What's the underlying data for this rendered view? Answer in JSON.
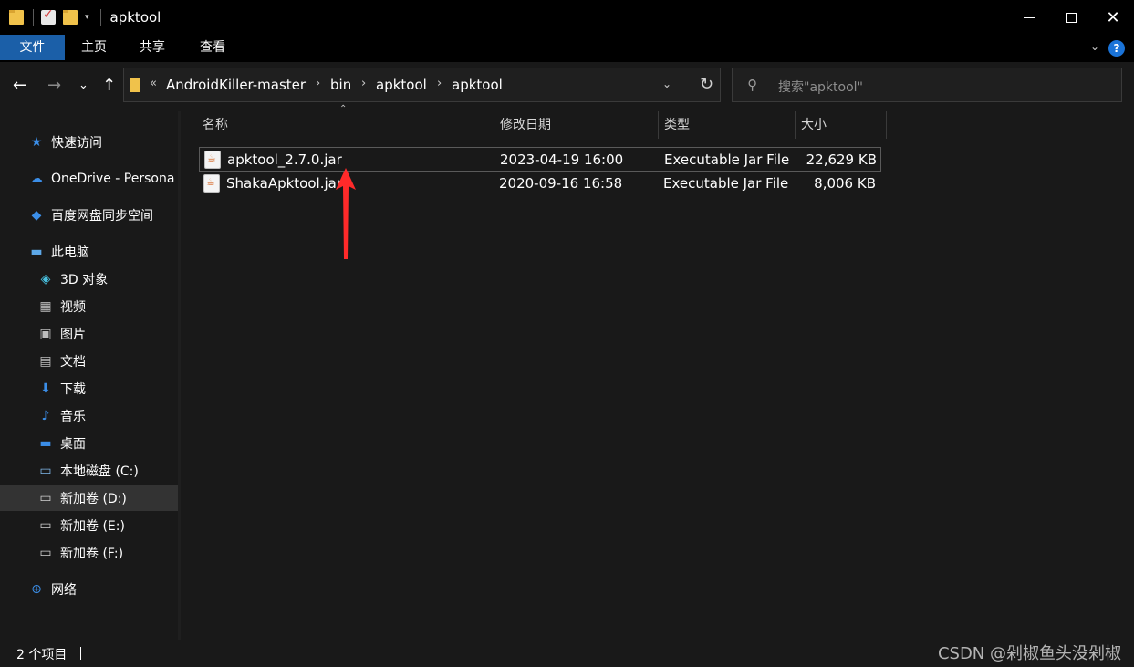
{
  "window": {
    "title": "apktool",
    "qa_dropdown": "▾",
    "minimize": "",
    "maximize": "",
    "close": "✕"
  },
  "ribbon": {
    "tabs": [
      {
        "label": "文件",
        "active": true
      },
      {
        "label": "主页",
        "active": false
      },
      {
        "label": "共享",
        "active": false
      },
      {
        "label": "查看",
        "active": false
      }
    ],
    "expand": "⌄",
    "help": "?"
  },
  "nav": {
    "back": "←",
    "forward": "→",
    "recent": "⌄",
    "up": "↑"
  },
  "address": {
    "overflow": "«",
    "segments": [
      "AndroidKiller-master",
      "bin",
      "apktool",
      "apktool"
    ],
    "separator": "›",
    "dropdown": "⌄",
    "refresh": "↻"
  },
  "search": {
    "placeholder": "搜索\"apktool\""
  },
  "sidebar": {
    "items": [
      {
        "label": "快速访问",
        "icon": "star-icon",
        "glyph": "★",
        "color": "#3b8ee8"
      },
      {
        "label": "OneDrive - Persona",
        "icon": "cloud-icon",
        "glyph": "☁",
        "color": "#3b8ee8"
      },
      {
        "label": "百度网盘同步空间",
        "icon": "baidu-sync-icon",
        "glyph": "◆",
        "color": "#3b8ee8"
      },
      {
        "label": "此电脑",
        "icon": "computer-icon",
        "glyph": "▬",
        "color": "#5da8e8"
      },
      {
        "label": "3D 对象",
        "icon": "cube-icon",
        "glyph": "◈",
        "color": "#49c1e0"
      },
      {
        "label": "视频",
        "icon": "video-icon",
        "glyph": "▦",
        "color": "#bcbcbc"
      },
      {
        "label": "图片",
        "icon": "picture-icon",
        "glyph": "▣",
        "color": "#bcbcbc"
      },
      {
        "label": "文档",
        "icon": "document-icon",
        "glyph": "▤",
        "color": "#bcbcbc"
      },
      {
        "label": "下载",
        "icon": "download-icon",
        "glyph": "⬇",
        "color": "#3b8ee8"
      },
      {
        "label": "音乐",
        "icon": "music-icon",
        "glyph": "♪",
        "color": "#3b8ee8"
      },
      {
        "label": "桌面",
        "icon": "desktop-icon",
        "glyph": "▬",
        "color": "#3b8ee8"
      },
      {
        "label": "本地磁盘 (C:)",
        "icon": "drive-c-icon",
        "glyph": "▭",
        "color": "#7fb7e8"
      },
      {
        "label": "新加卷 (D:)",
        "icon": "drive-icon",
        "glyph": "▭",
        "color": "#d0d0d0"
      },
      {
        "label": "新加卷 (E:)",
        "icon": "drive-icon",
        "glyph": "▭",
        "color": "#d0d0d0"
      },
      {
        "label": "新加卷 (F:)",
        "icon": "drive-icon",
        "glyph": "▭",
        "color": "#d0d0d0"
      },
      {
        "label": "网络",
        "icon": "network-icon",
        "glyph": "⊕",
        "color": "#3b8ee8"
      }
    ]
  },
  "columns": {
    "name": "名称",
    "date": "修改日期",
    "type": "类型",
    "size": "大小",
    "sort": "⌃"
  },
  "files": [
    {
      "name": "apktool_2.7.0.jar",
      "date": "2023-04-19 16:00",
      "type": "Executable Jar File",
      "size": "22,629 KB"
    },
    {
      "name": "ShakaApktool.jar",
      "date": "2020-09-16 16:58",
      "type": "Executable Jar File",
      "size": "8,006 KB"
    }
  ],
  "status": {
    "count": "2 个项目"
  },
  "watermark": "CSDN @剁椒鱼头没剁椒",
  "colors": {
    "accent": "#1b5fa8",
    "annotation": "#ff2a2a"
  }
}
